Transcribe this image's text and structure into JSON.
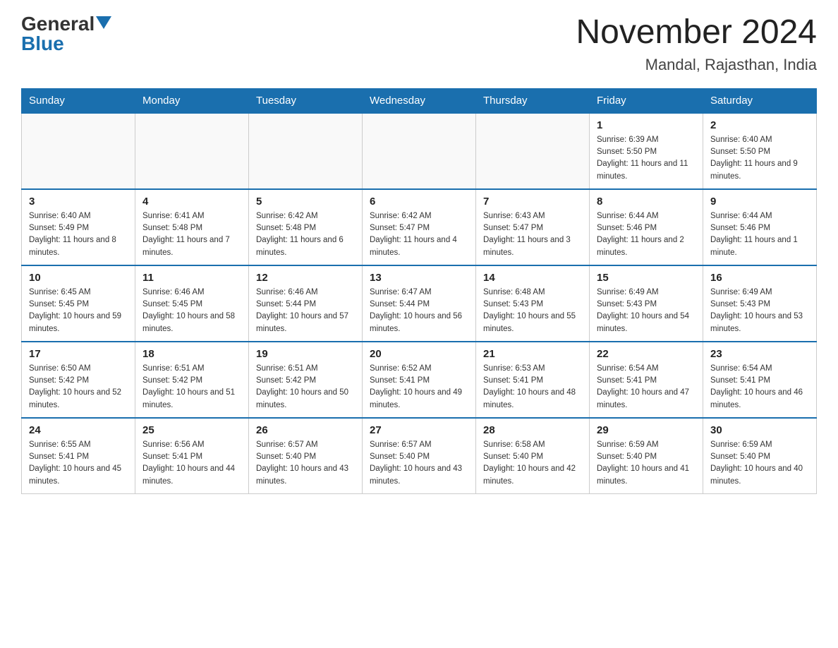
{
  "header": {
    "logo_general": "General",
    "logo_blue": "Blue",
    "month_title": "November 2024",
    "location": "Mandal, Rajasthan, India"
  },
  "weekdays": [
    "Sunday",
    "Monday",
    "Tuesday",
    "Wednesday",
    "Thursday",
    "Friday",
    "Saturday"
  ],
  "weeks": [
    [
      {
        "day": "",
        "info": ""
      },
      {
        "day": "",
        "info": ""
      },
      {
        "day": "",
        "info": ""
      },
      {
        "day": "",
        "info": ""
      },
      {
        "day": "",
        "info": ""
      },
      {
        "day": "1",
        "info": "Sunrise: 6:39 AM\nSunset: 5:50 PM\nDaylight: 11 hours and 11 minutes."
      },
      {
        "day": "2",
        "info": "Sunrise: 6:40 AM\nSunset: 5:50 PM\nDaylight: 11 hours and 9 minutes."
      }
    ],
    [
      {
        "day": "3",
        "info": "Sunrise: 6:40 AM\nSunset: 5:49 PM\nDaylight: 11 hours and 8 minutes."
      },
      {
        "day": "4",
        "info": "Sunrise: 6:41 AM\nSunset: 5:48 PM\nDaylight: 11 hours and 7 minutes."
      },
      {
        "day": "5",
        "info": "Sunrise: 6:42 AM\nSunset: 5:48 PM\nDaylight: 11 hours and 6 minutes."
      },
      {
        "day": "6",
        "info": "Sunrise: 6:42 AM\nSunset: 5:47 PM\nDaylight: 11 hours and 4 minutes."
      },
      {
        "day": "7",
        "info": "Sunrise: 6:43 AM\nSunset: 5:47 PM\nDaylight: 11 hours and 3 minutes."
      },
      {
        "day": "8",
        "info": "Sunrise: 6:44 AM\nSunset: 5:46 PM\nDaylight: 11 hours and 2 minutes."
      },
      {
        "day": "9",
        "info": "Sunrise: 6:44 AM\nSunset: 5:46 PM\nDaylight: 11 hours and 1 minute."
      }
    ],
    [
      {
        "day": "10",
        "info": "Sunrise: 6:45 AM\nSunset: 5:45 PM\nDaylight: 10 hours and 59 minutes."
      },
      {
        "day": "11",
        "info": "Sunrise: 6:46 AM\nSunset: 5:45 PM\nDaylight: 10 hours and 58 minutes."
      },
      {
        "day": "12",
        "info": "Sunrise: 6:46 AM\nSunset: 5:44 PM\nDaylight: 10 hours and 57 minutes."
      },
      {
        "day": "13",
        "info": "Sunrise: 6:47 AM\nSunset: 5:44 PM\nDaylight: 10 hours and 56 minutes."
      },
      {
        "day": "14",
        "info": "Sunrise: 6:48 AM\nSunset: 5:43 PM\nDaylight: 10 hours and 55 minutes."
      },
      {
        "day": "15",
        "info": "Sunrise: 6:49 AM\nSunset: 5:43 PM\nDaylight: 10 hours and 54 minutes."
      },
      {
        "day": "16",
        "info": "Sunrise: 6:49 AM\nSunset: 5:43 PM\nDaylight: 10 hours and 53 minutes."
      }
    ],
    [
      {
        "day": "17",
        "info": "Sunrise: 6:50 AM\nSunset: 5:42 PM\nDaylight: 10 hours and 52 minutes."
      },
      {
        "day": "18",
        "info": "Sunrise: 6:51 AM\nSunset: 5:42 PM\nDaylight: 10 hours and 51 minutes."
      },
      {
        "day": "19",
        "info": "Sunrise: 6:51 AM\nSunset: 5:42 PM\nDaylight: 10 hours and 50 minutes."
      },
      {
        "day": "20",
        "info": "Sunrise: 6:52 AM\nSunset: 5:41 PM\nDaylight: 10 hours and 49 minutes."
      },
      {
        "day": "21",
        "info": "Sunrise: 6:53 AM\nSunset: 5:41 PM\nDaylight: 10 hours and 48 minutes."
      },
      {
        "day": "22",
        "info": "Sunrise: 6:54 AM\nSunset: 5:41 PM\nDaylight: 10 hours and 47 minutes."
      },
      {
        "day": "23",
        "info": "Sunrise: 6:54 AM\nSunset: 5:41 PM\nDaylight: 10 hours and 46 minutes."
      }
    ],
    [
      {
        "day": "24",
        "info": "Sunrise: 6:55 AM\nSunset: 5:41 PM\nDaylight: 10 hours and 45 minutes."
      },
      {
        "day": "25",
        "info": "Sunrise: 6:56 AM\nSunset: 5:41 PM\nDaylight: 10 hours and 44 minutes."
      },
      {
        "day": "26",
        "info": "Sunrise: 6:57 AM\nSunset: 5:40 PM\nDaylight: 10 hours and 43 minutes."
      },
      {
        "day": "27",
        "info": "Sunrise: 6:57 AM\nSunset: 5:40 PM\nDaylight: 10 hours and 43 minutes."
      },
      {
        "day": "28",
        "info": "Sunrise: 6:58 AM\nSunset: 5:40 PM\nDaylight: 10 hours and 42 minutes."
      },
      {
        "day": "29",
        "info": "Sunrise: 6:59 AM\nSunset: 5:40 PM\nDaylight: 10 hours and 41 minutes."
      },
      {
        "day": "30",
        "info": "Sunrise: 6:59 AM\nSunset: 5:40 PM\nDaylight: 10 hours and 40 minutes."
      }
    ]
  ]
}
